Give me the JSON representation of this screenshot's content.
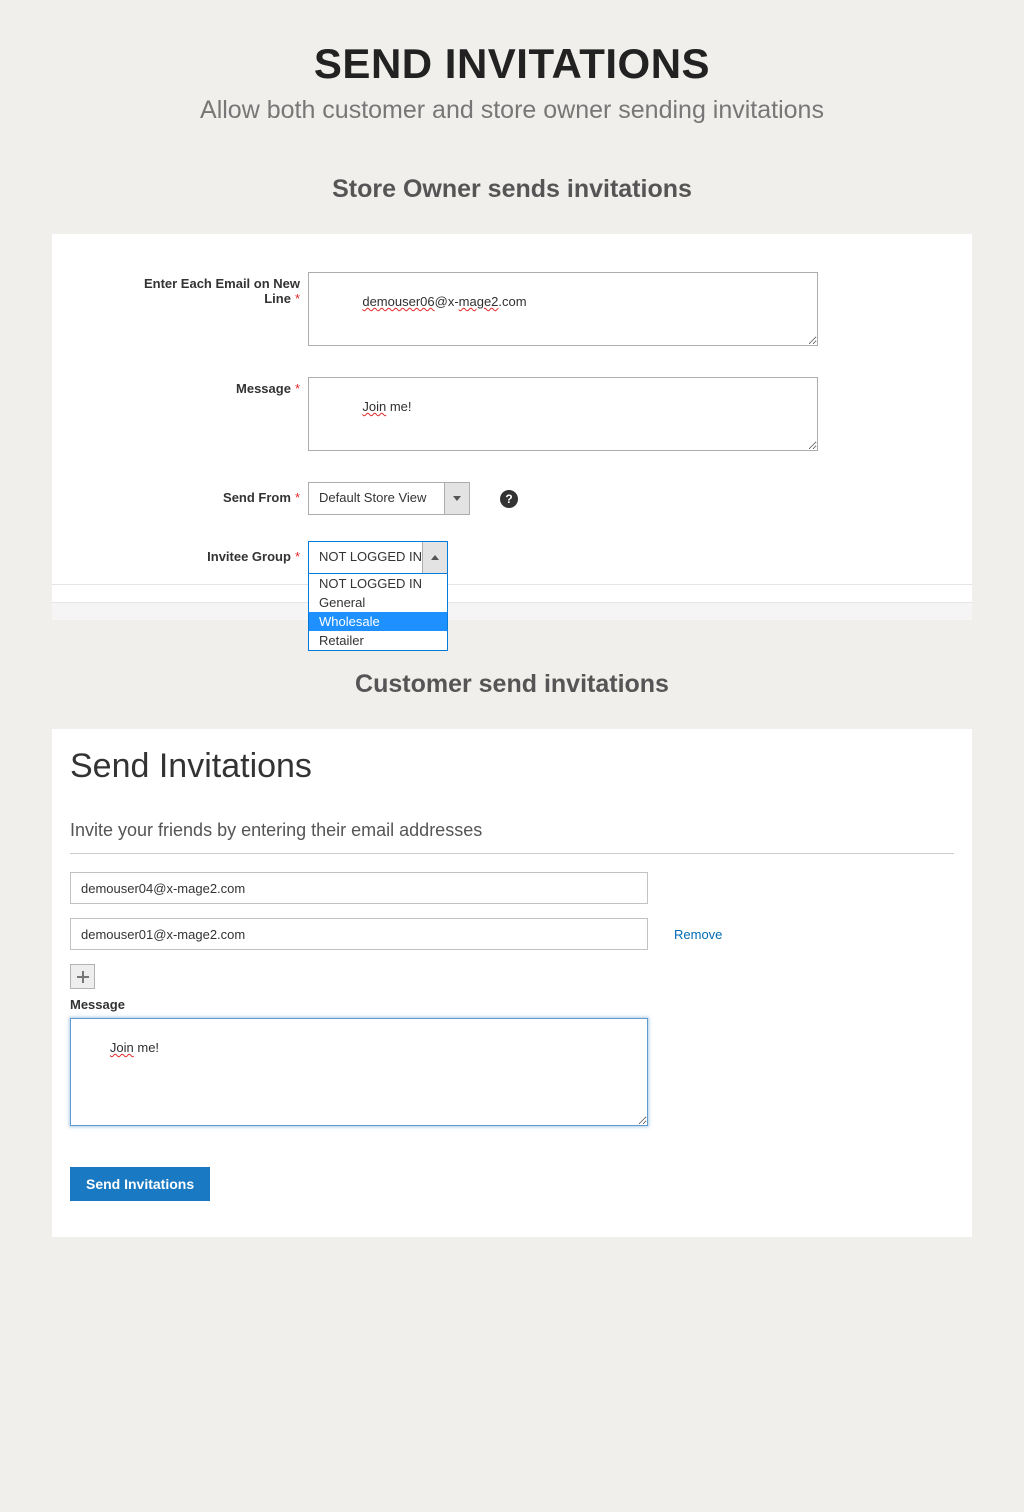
{
  "header": {
    "title": "SEND INVITATIONS",
    "subtitle": "Allow both customer and store owner sending invitations"
  },
  "admin": {
    "heading": "Store Owner sends invitations",
    "email_label": "Enter Each Email on New Line",
    "email_value_p1": "demouser06",
    "email_value_p2": "@x-",
    "email_value_p3": "mage2",
    "email_value_p4": ".com",
    "message_label": "Message",
    "message_value_p1": "Join",
    "message_value_p2": " me!",
    "send_from_label": "Send From",
    "send_from_value": "Default Store View",
    "invitee_label": "Invitee Group",
    "invitee_value": "NOT LOGGED IN",
    "invitee_options": {
      "0": "NOT LOGGED IN",
      "1": "General",
      "2": "Wholesale",
      "3": "Retailer"
    }
  },
  "customer": {
    "heading": "Customer send invitations",
    "panel_title": "Send Invitations",
    "panel_sub": "Invite your friends by entering their email addresses",
    "email1": "demouser04@x-mage2.com",
    "email2": "demouser01@x-mage2.com",
    "remove_label": "Remove",
    "message_label": "Message",
    "message_value_p1": "Join",
    "message_value_p2": " me!",
    "send_button": "Send Invitations"
  }
}
